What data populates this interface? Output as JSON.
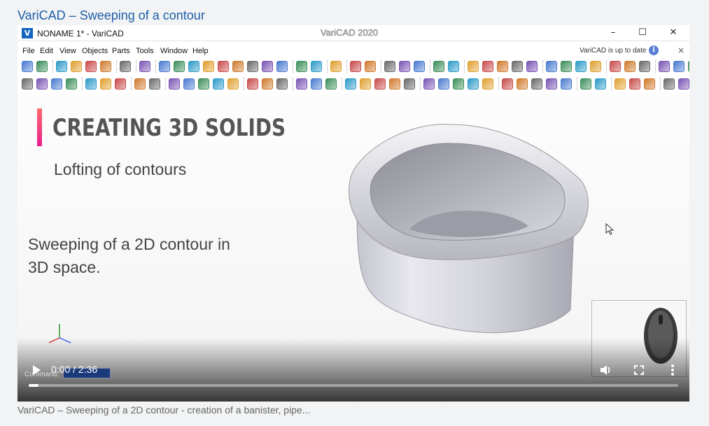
{
  "page": {
    "title": "VariCAD – Sweeping of a contour",
    "caption": "VariCAD – Sweeping of a 2D contour - creation of a banister, pipe..."
  },
  "window": {
    "logo_text": "V",
    "title": "NONAME 1* - VariCAD",
    "center_title": "VariCAD 2020",
    "minimize": "–",
    "maximize": "☐",
    "close": "✕"
  },
  "menu": {
    "items": [
      "File",
      "Edit",
      "View",
      "Objects",
      "Parts",
      "Tools",
      "Window",
      "Help"
    ],
    "update_note": "VariCAD is up to date",
    "info": "i",
    "close": "×"
  },
  "slide": {
    "heading": "CREATING 3D SOLIDS",
    "subheading": "Lofting of contours",
    "description": "Sweeping of a 2D contour in 3D space."
  },
  "command": {
    "label": "Command:"
  },
  "player": {
    "time": "0:00 / 2:36",
    "progress": 0.015
  },
  "colors": {
    "accent": "#1f5ea8",
    "heading_bar_top": "#ff6b6b",
    "heading_bar_bottom": "#e91e8c"
  }
}
